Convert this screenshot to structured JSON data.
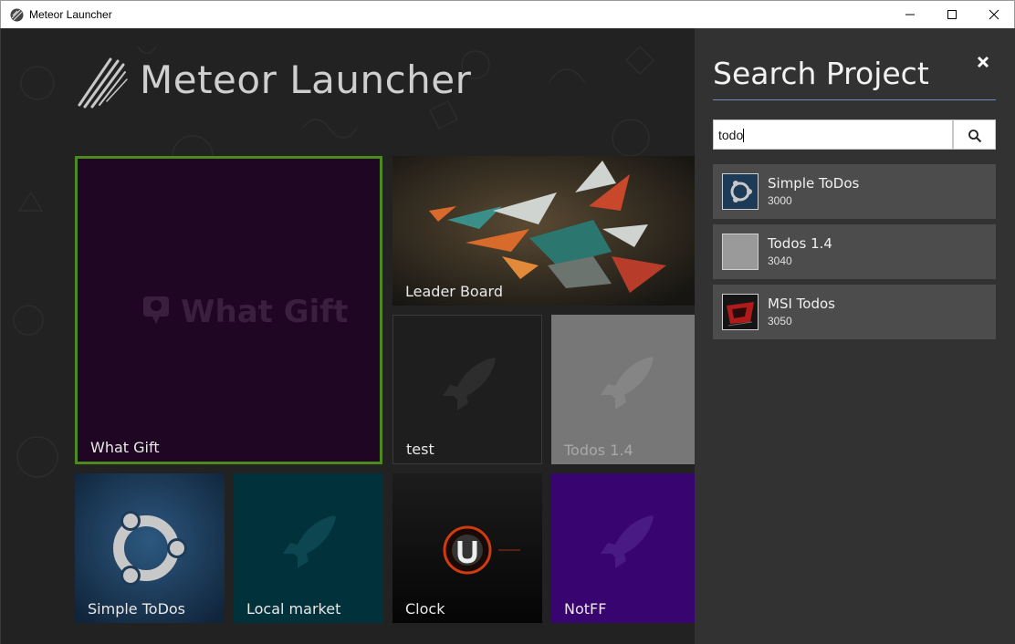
{
  "window": {
    "title": "Meteor Launcher",
    "minimize_icon": "minimize-icon",
    "maximize_icon": "maximize-icon",
    "close_icon": "close-icon"
  },
  "header": {
    "brand": "Meteor Launcher",
    "logo_icon": "meteor-logo-icon"
  },
  "tiles": [
    {
      "label": "What Gift",
      "watermark": "What Gift",
      "color": "#1f0622",
      "border": "#4c8a1d"
    },
    {
      "label": "Leader Board",
      "color": "#2b2a27",
      "image": "graffiti"
    },
    {
      "label": "test",
      "color": "#1e1e1e",
      "icon": "rocket-icon"
    },
    {
      "label": "Todos 1.4",
      "color": "#777777",
      "icon": "rocket-icon"
    },
    {
      "label": "Simple ToDos",
      "color": "#1d3a57",
      "image": "ubuntu-logo"
    },
    {
      "label": "Local market",
      "color": "#01313a",
      "icon": "rocket-icon"
    },
    {
      "label": "Clock",
      "color": "#0b0b0b",
      "image": "u-logo"
    },
    {
      "label": "NotFF",
      "color": "#380470",
      "icon": "rocket-icon"
    }
  ],
  "search_panel": {
    "title": "Search Project",
    "query": "todo",
    "close_icon": "close-icon",
    "search_icon": "search-icon",
    "accent": "#6e8db8",
    "results": [
      {
        "name": "Simple ToDos",
        "port": "3000",
        "thumb": "ubuntu-logo"
      },
      {
        "name": "Todos 1.4",
        "port": "3040",
        "thumb": "blank-gray"
      },
      {
        "name": "MSI Todos",
        "port": "3050",
        "thumb": "msi-logo"
      }
    ]
  }
}
